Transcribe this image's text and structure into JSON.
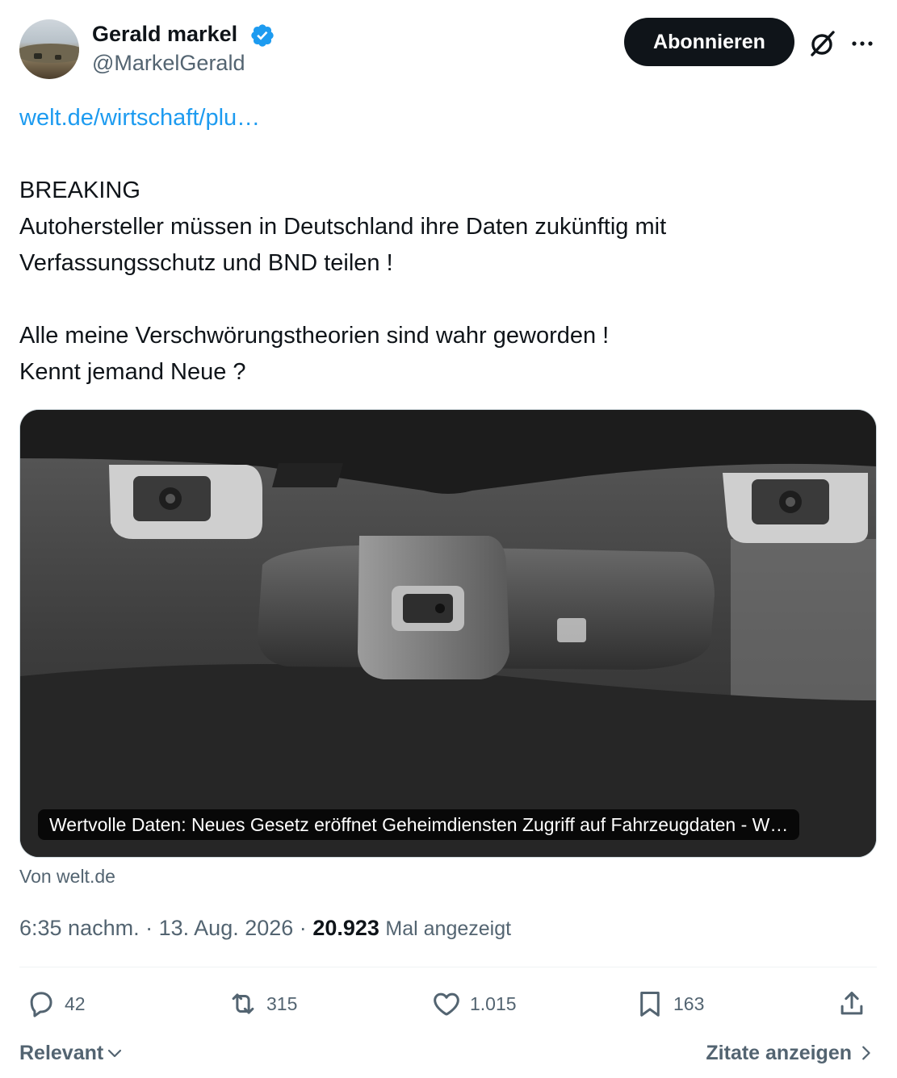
{
  "author": {
    "display_name": "Gerald markel",
    "handle": "@MarkelGerald",
    "verified_color": "#1d9bf0"
  },
  "header": {
    "follow_label": "Abonnieren",
    "grok_icon": "grok-icon",
    "more_icon": "more-icon"
  },
  "tweet": {
    "link": "welt.de/wirtschaft/plu…",
    "lines": [
      "BREAKING",
      "Autohersteller müssen in Deutschland ihre Daten zukünftig mit",
      "Verfassungsschutz und BND teilen !",
      "",
      "Alle meine Verschwörungstheorien sind wahr geworden !",
      "Kennt jemand Neue ?"
    ]
  },
  "card": {
    "caption": "Wertvolle Daten: Neues Gesetz eröffnet Geheimdiensten Zugriff auf Fahrzeugdaten - W…",
    "source": "Von welt.de",
    "image_subject": "car windshield cameras and rearview mirror"
  },
  "meta": {
    "time": "6:35 nachm.",
    "separator": "·",
    "date": "13. Aug. 2026",
    "views_count": "20.923",
    "views_label": "Mal angezeigt"
  },
  "actions": {
    "replies": "42",
    "reposts": "315",
    "likes": "1.015",
    "bookmarks": "163"
  },
  "footer": {
    "sort_label": "Relevant",
    "quotes_label": "Zitate anzeigen"
  },
  "colors": {
    "link": "#1d9bf0",
    "text": "#0f1419",
    "secondary": "#536471"
  }
}
